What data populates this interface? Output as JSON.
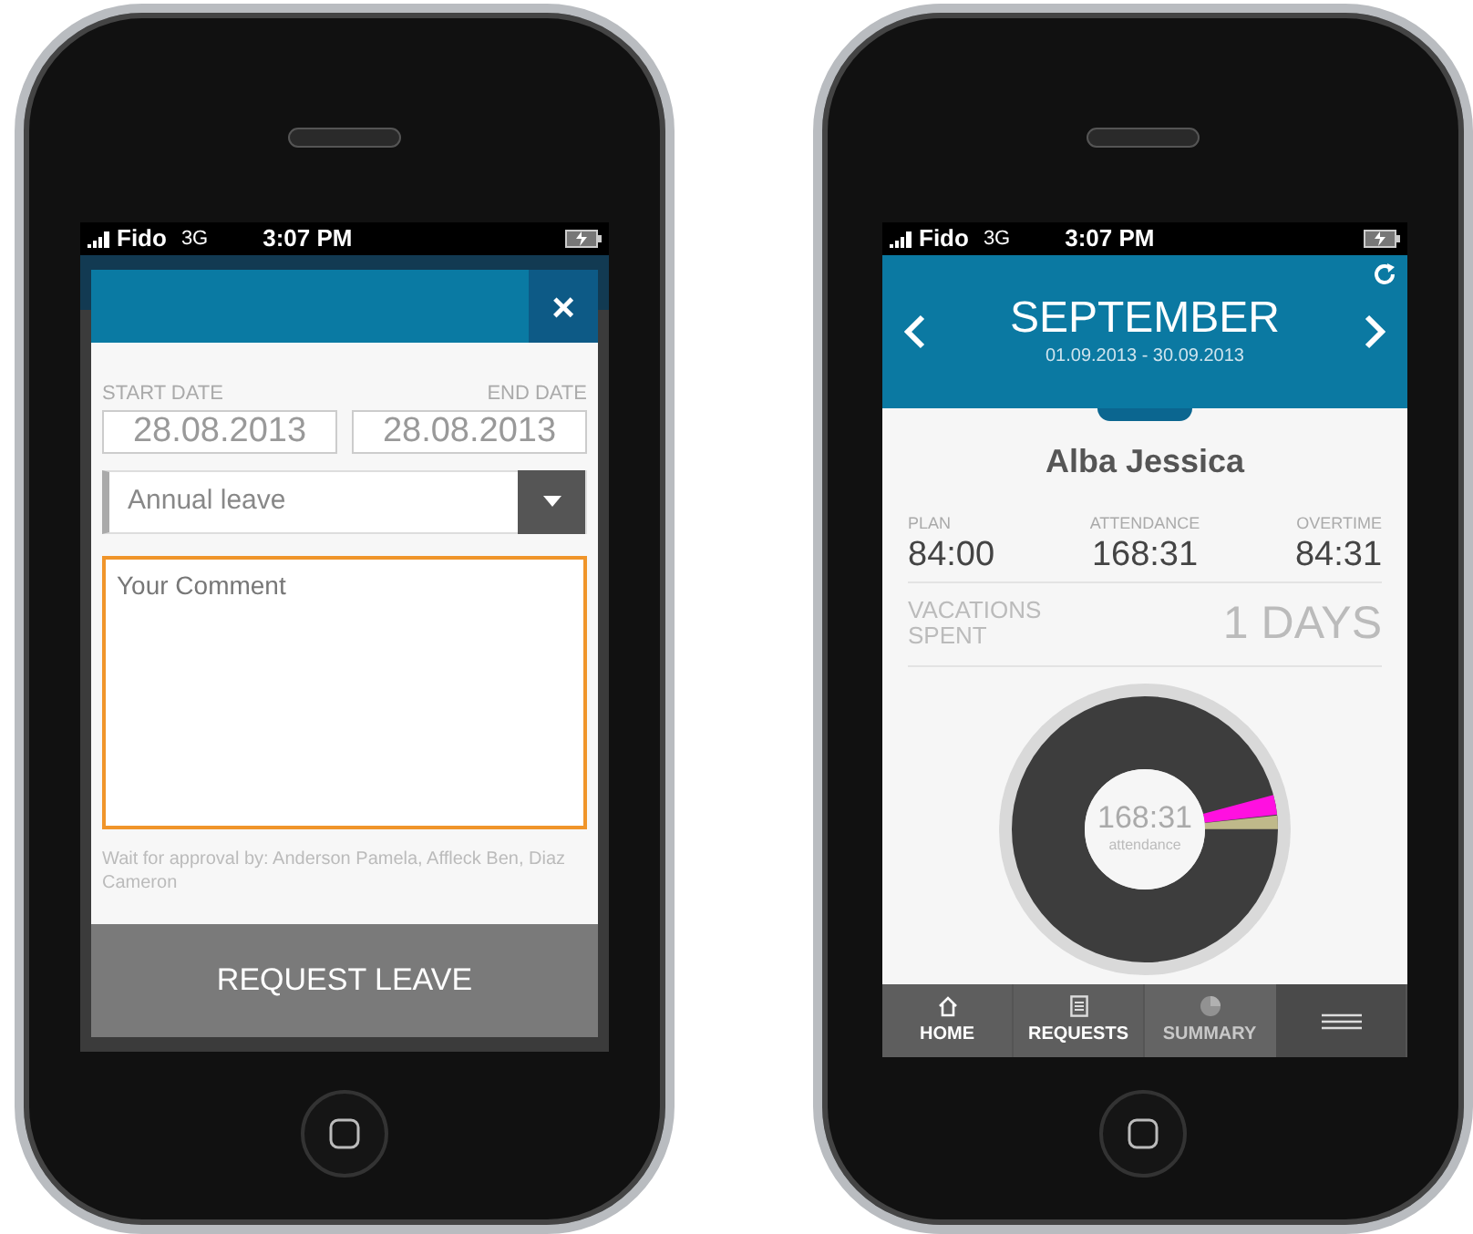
{
  "request_leave_screen": {
    "status_bar": {
      "carrier": "Fido",
      "network": "3G",
      "time": "3:07 PM"
    },
    "modal": {
      "close": "×",
      "start_date_label": "START DATE",
      "end_date_label": "END DATE",
      "start_date": "28.08.2013",
      "end_date": "28.08.2013",
      "leave_type": "Annual leave",
      "comment_placeholder": "Your Comment",
      "approval_note": "Wait for approval by: Anderson Pamela, Affleck Ben, Diaz Cameron",
      "submit_button": "REQUEST LEAVE"
    }
  },
  "summary_screen": {
    "status_bar": {
      "carrier": "Fido",
      "network": "3G",
      "time": "3:07 PM"
    },
    "month": "SEPTEMBER",
    "date_range": "01.09.2013 - 30.09.2013",
    "employee": "Alba Jessica",
    "stats": [
      {
        "label": "PLAN",
        "value": "84:00"
      },
      {
        "label": "ATTENDANCE",
        "value": "168:31"
      },
      {
        "label": "OVERTIME",
        "value": "84:31"
      }
    ],
    "vacations": {
      "label": "VACATIONS SPENT",
      "value": "1 DAYS"
    },
    "donut": {
      "value": "168:31",
      "label": "attendance"
    },
    "nav": [
      {
        "kind": "home",
        "label": "HOME",
        "disabled": false
      },
      {
        "kind": "requests",
        "label": "REQUESTS",
        "disabled": false
      },
      {
        "kind": "summary",
        "label": "SUMMARY",
        "disabled": true
      },
      {
        "kind": "menu",
        "disabled": false
      }
    ]
  }
}
